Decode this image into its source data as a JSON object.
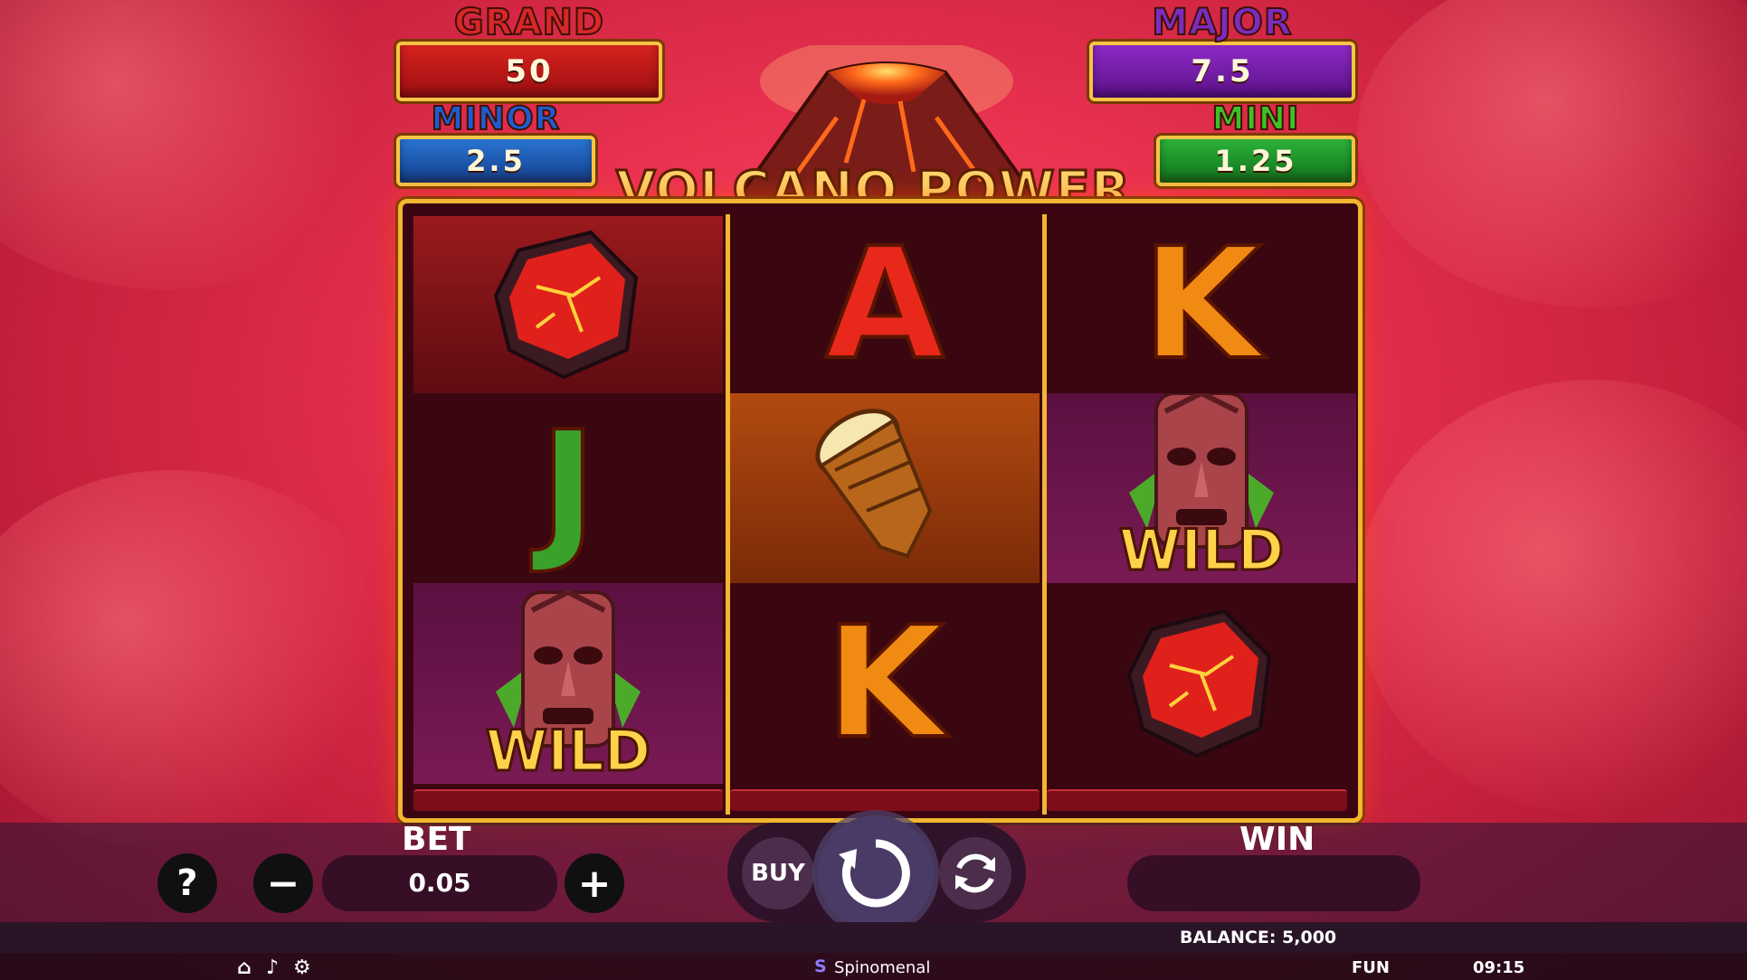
{
  "game_title": "VOLCANO POWER",
  "jackpots": {
    "grand": {
      "label": "GRAND",
      "value": "50",
      "color": "#c01818",
      "title_color": "#d8262a"
    },
    "major": {
      "label": "MAJOR",
      "value": "7.5",
      "color": "#7a1fa8",
      "title_color": "#7d2bc0"
    },
    "minor": {
      "label": "MINOR",
      "value": "2.5",
      "color": "#1c5fb8",
      "title_color": "#1f5cd0"
    },
    "mini": {
      "label": "MINI",
      "value": "1.25",
      "color": "#1f9a2c",
      "title_color": "#3fbf2a"
    }
  },
  "reels": [
    [
      "lava-stone",
      "J",
      "WILD"
    ],
    [
      "A",
      "drum",
      "K"
    ],
    [
      "K",
      "WILD",
      "lava-stone"
    ]
  ],
  "wild_label": "WILD",
  "controls": {
    "bet_label": "BET",
    "bet_value": "0.05",
    "win_label": "WIN",
    "win_value": "",
    "buy_label": "BUY",
    "help_label": "?",
    "minus_label": "−",
    "plus_label": "+"
  },
  "status": {
    "balance": "BALANCE: 5,000",
    "mode": "FUN",
    "time": "09:15",
    "brand": "Spinomenal"
  },
  "colors": {
    "frame_gold": "#f2b630",
    "letter_red": "#e8281a",
    "letter_orange": "#f08a12",
    "letter_green": "#3aa12a"
  }
}
